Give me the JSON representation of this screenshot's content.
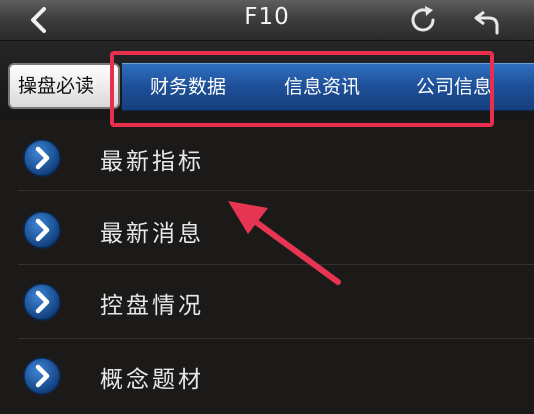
{
  "header": {
    "title": "F10",
    "back_icon": "chevron-left-icon",
    "refresh_icon": "refresh-icon",
    "return_icon": "undo-arrow-icon"
  },
  "tabs": {
    "active": "操盘必读",
    "items": [
      "财务数据",
      "信息资讯",
      "公司信息"
    ]
  },
  "list": {
    "items": [
      "最新指标",
      "最新消息",
      "控盘情况",
      "概念题材"
    ]
  },
  "colors": {
    "tab_blue": "#1e4f97",
    "highlight_red": "#ea2f4e",
    "background": "#1c1a18"
  }
}
